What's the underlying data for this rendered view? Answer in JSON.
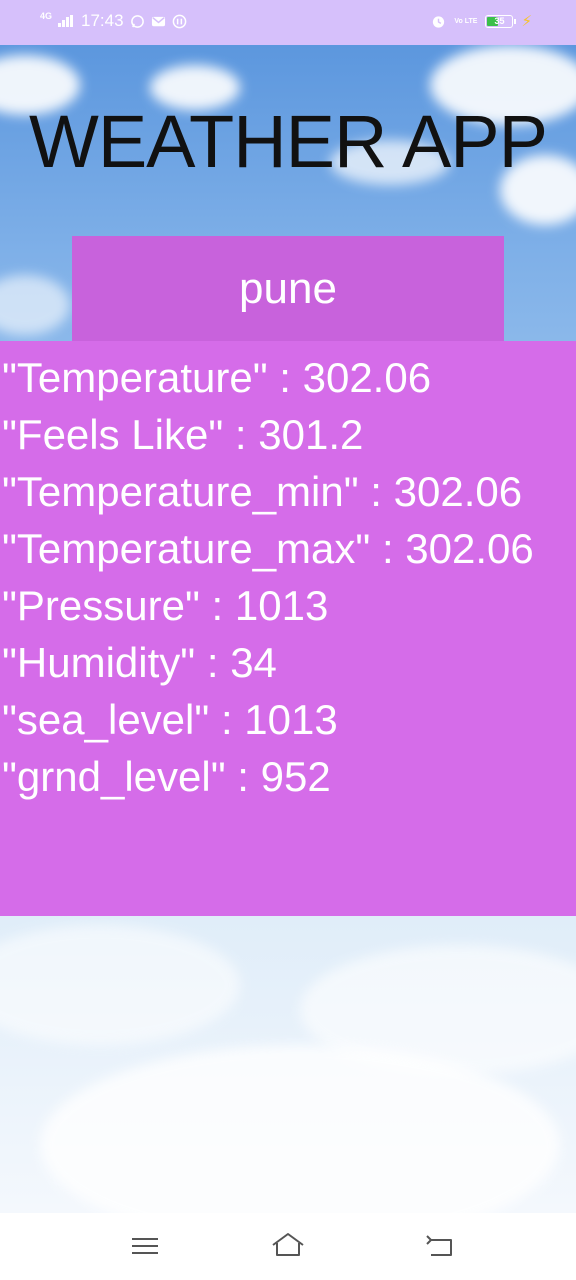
{
  "status_bar": {
    "network": "4G",
    "time": "17:43",
    "battery_level": "35",
    "volte": "Vo LTE"
  },
  "app": {
    "title": "WEATHER APP",
    "city": "pune"
  },
  "weather_info": [
    "\"Temperature\" : 302.06",
    "\"Feels Like\" : 301.2",
    "\"Temperature_min\" : 302.06",
    "\"Temperature_max\" : 302.06",
    "\"Pressure\" : 1013",
    "\"Humidity\" : 34",
    "\"sea_level\" : 1013",
    "\"grnd_level\" : 952"
  ],
  "colors": {
    "status_bar": "#d6c0fb",
    "city_box": "#c862dc",
    "info_panel": "#d56ce9"
  },
  "nav": {
    "icons": [
      "menu-icon",
      "home-icon",
      "back-icon"
    ]
  }
}
